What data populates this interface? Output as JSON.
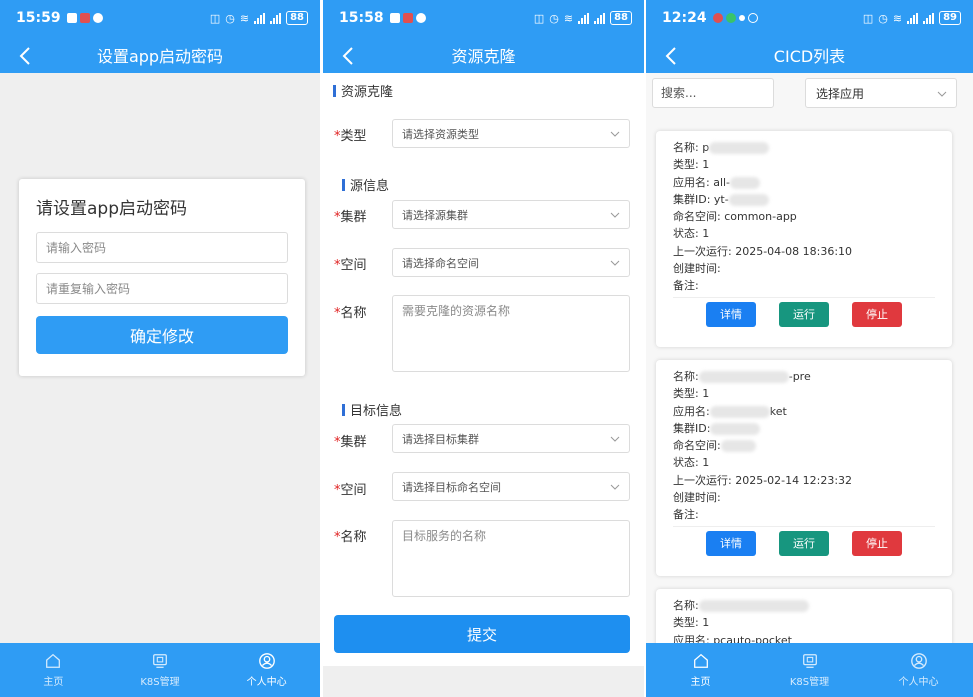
{
  "screen1": {
    "status": {
      "time": "15:59",
      "battery": "88"
    },
    "nav_title": "设置app启动密码",
    "card_title": "请设置app启动密码",
    "password_placeholder": "请输入密码",
    "repeat_placeholder": "请重复输入密码",
    "confirm_label": "确定修改",
    "tabs": [
      {
        "label": "主页",
        "icon": "home-icon"
      },
      {
        "label": "K8S管理",
        "icon": "k8s-icon"
      },
      {
        "label": "个人中心",
        "icon": "user-icon"
      }
    ],
    "active_tab": 2
  },
  "screen2": {
    "status": {
      "time": "15:58",
      "battery": "88"
    },
    "nav_title": "资源克隆",
    "section_clone": "资源克隆",
    "section_source": "源信息",
    "section_target": "目标信息",
    "required_mark": "*",
    "fields": {
      "type": {
        "label": "类型",
        "placeholder": "请选择资源类型"
      },
      "src_cluster": {
        "label": "集群",
        "placeholder": "请选择源集群"
      },
      "src_namespace": {
        "label": "空间",
        "placeholder": "请选择命名空间"
      },
      "src_name": {
        "label": "名称",
        "placeholder": "需要克隆的资源名称"
      },
      "dst_cluster": {
        "label": "集群",
        "placeholder": "请选择目标集群"
      },
      "dst_namespace": {
        "label": "空间",
        "placeholder": "请选择目标命名空间"
      },
      "dst_name": {
        "label": "名称",
        "placeholder": "目标服务的名称"
      }
    },
    "submit_label": "提交"
  },
  "screen3": {
    "status": {
      "time": "12:24",
      "battery": "89"
    },
    "nav_title": "CICD列表",
    "search_placeholder": "搜索...",
    "app_select_label": "选择应用",
    "buttons": {
      "detail": "详情",
      "run": "运行",
      "stop": "停止"
    },
    "cards": [
      {
        "name_label": "名称: p",
        "type_label": "类型: 1",
        "app_label": "应用名: all-",
        "cluster_label": "集群ID: yt-",
        "namespace_label": "命名空间: common-app",
        "state_label": "状态: 1",
        "last_run_label": "上一次运行: 2025-04-08 18:36:10",
        "created_label": "创建时间:",
        "remark_label": "备注:"
      },
      {
        "name_label": "名称:",
        "name_suffix": "-pre",
        "type_label": "类型: 1",
        "app_label": "应用名:",
        "app_suffix": "ket",
        "cluster_label": "集群ID:",
        "namespace_label": "命名空间:",
        "state_label": "状态: 1",
        "last_run_label": "上一次运行: 2025-02-14 12:23:32",
        "created_label": "创建时间:",
        "remark_label": "备注:"
      },
      {
        "name_label": "名称:",
        "type_label": "类型: 1",
        "app_label": "应用名: pcauto-pocket"
      }
    ],
    "tabs": [
      {
        "label": "主页",
        "icon": "home-icon"
      },
      {
        "label": "K8S管理",
        "icon": "k8s-icon"
      },
      {
        "label": "个人中心",
        "icon": "user-icon"
      }
    ],
    "active_tab": 0
  }
}
